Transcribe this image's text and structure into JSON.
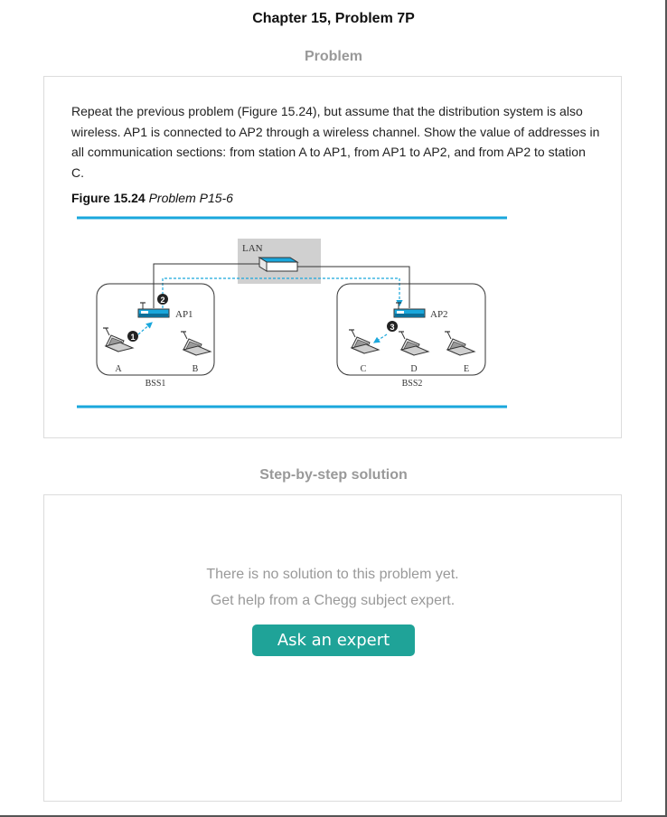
{
  "header": {
    "chapter_title": "Chapter 15, Problem 7P"
  },
  "problem": {
    "heading": "Problem",
    "text": "Repeat the previous problem (Figure 15.24), but assume that the distribution system is also wireless. AP1 is connected to AP2 through a wireless channel. Show the value of addresses in all communication sections: from station A to AP1, from AP1 to AP2, and from AP2 to station C.",
    "figure_number": "Figure 15.24",
    "figure_title": "Problem P15-6",
    "figure": {
      "lan_label": "LAN",
      "ap1_label": "AP1",
      "ap2_label": "AP2",
      "bss1_label": "BSS1",
      "bss2_label": "BSS2",
      "station_a": "A",
      "station_b": "B",
      "station_c": "C",
      "station_d": "D",
      "station_e": "E",
      "step1": "1",
      "step2": "2",
      "step3": "3",
      "accent_color": "#1aa7dc"
    }
  },
  "solution": {
    "heading": "Step-by-step solution",
    "no_solution_line1": "There is no solution to this problem yet.",
    "no_solution_line2": "Get help from a Chegg subject expert.",
    "ask_button": "Ask an expert",
    "button_color": "#1fa398"
  }
}
